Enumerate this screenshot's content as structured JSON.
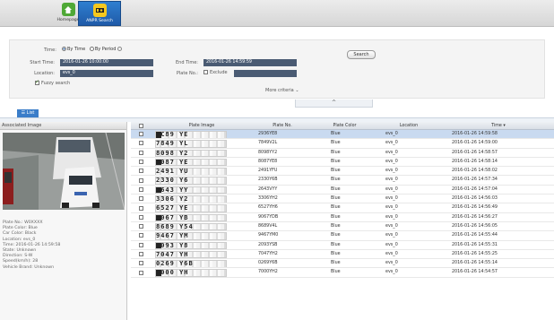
{
  "nav": {
    "items": [
      {
        "label": "Homepage"
      },
      {
        "label": "ANPR Search"
      }
    ]
  },
  "search": {
    "time_label": "Time:",
    "by_time": "By Time",
    "by_period": "By Period",
    "start_label": "Start Time:",
    "start_value": "2016-01-26 10:00:00",
    "end_label": "End Time:",
    "end_value": "2016-01-26 14:59:59",
    "location_label": "Location:",
    "location_value": "evs_0",
    "plate_no_label": "Plate No.:",
    "exclude_label": "Exclude",
    "fuzzy_label": "Fuzzy search",
    "search_button": "Search",
    "more_criteria": "More criteria"
  },
  "list_label": "List",
  "associated": {
    "header": "Associated Image",
    "info_lines": [
      "Plate No.: W0XXXX",
      "Plate Color: Blue",
      "Car Color: Black",
      "Location: evs_0",
      "Time: 2016-01-26 14:59:58",
      "State: Unknown",
      "Direction: S-W",
      "Speed(km/h): 28",
      "Vehicle Brand: Unknown"
    ]
  },
  "table": {
    "columns": [
      "Plate Image",
      "Plate No.",
      "Plate Color",
      "Location",
      "Time"
    ],
    "rows": [
      {
        "plate_img": "8C89 YE",
        "plate": "2936YE8",
        "color": "Blue",
        "location": "evs_0",
        "time": "2016-01-26 14:59:58",
        "selected": true
      },
      {
        "plate_img": "7849 YL",
        "plate": "7849V2L",
        "color": "Blue",
        "location": "evs_0",
        "time": "2016-01-26 14:59:00"
      },
      {
        "plate_img": "8098 Y2",
        "plate": "8098YY2",
        "color": "Blue",
        "location": "evs_0",
        "time": "2016-01-26 14:58:57"
      },
      {
        "plate_img": "8087 YE",
        "plate": "8087YE8",
        "color": "Blue",
        "location": "evs_0",
        "time": "2016-01-26 14:58:14"
      },
      {
        "plate_img": "2491 YU",
        "plate": "2491YFU",
        "color": "Blue",
        "location": "evs_0",
        "time": "2016-01-26 14:58:02"
      },
      {
        "plate_img": "2330 Y6",
        "plate": "2330Y6B",
        "color": "Blue",
        "location": "evs_0",
        "time": "2016-01-26 14:57:34"
      },
      {
        "plate_img": "2643 YY",
        "plate": "2643VYY",
        "color": "Blue",
        "location": "evs_0",
        "time": "2016-01-26 14:57:04"
      },
      {
        "plate_img": "3306 Y2",
        "plate": "3306YH2",
        "color": "Blue",
        "location": "evs_0",
        "time": "2016-01-26 14:56:03"
      },
      {
        "plate_img": "6527 YE",
        "plate": "6527YH6",
        "color": "Blue",
        "location": "evs_0",
        "time": "2016-01-26 14:56:49"
      },
      {
        "plate_img": "9067 YB",
        "plate": "9067YDB",
        "color": "Blue",
        "location": "evs_0",
        "time": "2016-01-26 14:56:27"
      },
      {
        "plate_img": "8689 Y54",
        "plate": "8689V4L",
        "color": "Blue",
        "location": "evs_0",
        "time": "2016-01-26 14:56:05"
      },
      {
        "plate_img": "9467 YM",
        "plate": "9467YM0",
        "color": "Blue",
        "location": "evs_0",
        "time": "2016-01-26 14:55:44"
      },
      {
        "plate_img": "2093 Y8",
        "plate": "2093YSB",
        "color": "Blue",
        "location": "evs_0",
        "time": "2016-01-26 14:55:31"
      },
      {
        "plate_img": "7047 YH",
        "plate": "7047YH2",
        "color": "Blue",
        "location": "evs_0",
        "time": "2016-01-26 14:55:25"
      },
      {
        "plate_img": "0269 Y6B",
        "plate": "0269Y6B",
        "color": "Blue",
        "location": "evs_0",
        "time": "2016-01-26 14:55:14"
      },
      {
        "plate_img": "7000 YH",
        "plate": "7000YH2",
        "color": "Blue",
        "location": "evs_0",
        "time": "2016-01-26 14:54:57"
      }
    ]
  },
  "colors": {
    "accent": "#3a7dc9",
    "field": "#4a5b73",
    "selected_row": "#c9daf0"
  }
}
